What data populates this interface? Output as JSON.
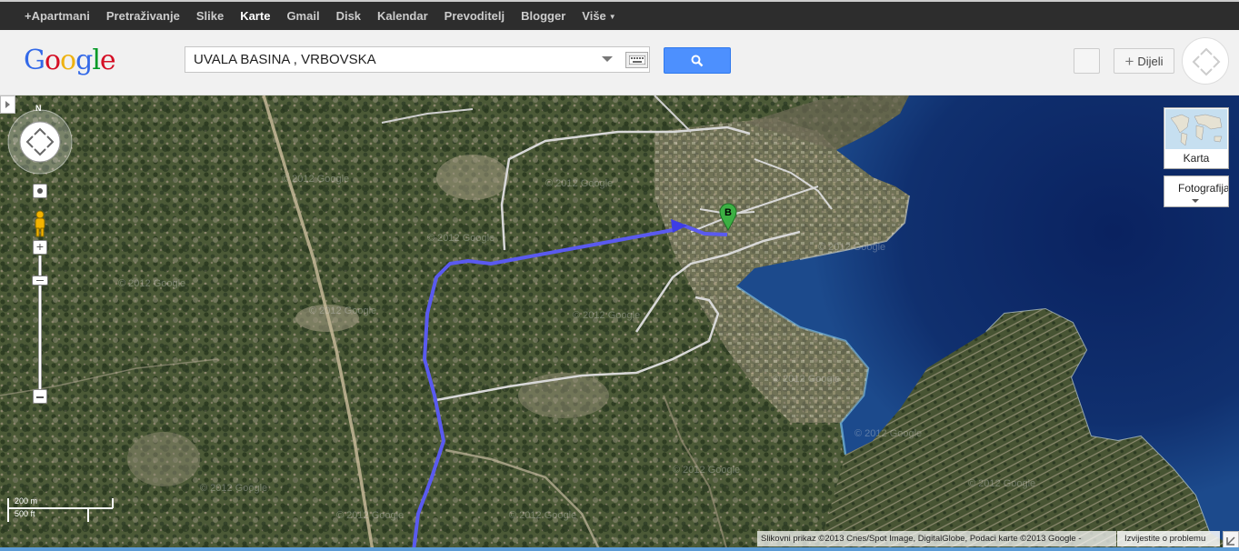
{
  "topbar": {
    "items": [
      {
        "label": "+Apartmani",
        "active": false
      },
      {
        "label": "Pretraživanje",
        "active": false
      },
      {
        "label": "Slike",
        "active": false
      },
      {
        "label": "Karte",
        "active": true
      },
      {
        "label": "Gmail",
        "active": false
      },
      {
        "label": "Disk",
        "active": false
      },
      {
        "label": "Kalendar",
        "active": false
      },
      {
        "label": "Prevoditelj",
        "active": false
      },
      {
        "label": "Blogger",
        "active": false
      },
      {
        "label": "Više",
        "active": false
      }
    ]
  },
  "header": {
    "logo_letters": [
      "G",
      "o",
      "o",
      "g",
      "l",
      "e"
    ],
    "search_value": "UVALA BASINA , VRBOVSKA",
    "share_label": "Dijeli"
  },
  "map": {
    "compass_label": "N",
    "marker_label": "B",
    "watermark_text": "© 2012 Google",
    "map_types": {
      "karta_label": "Karta",
      "foto_label": "Fotografija"
    },
    "scale": {
      "metric": "200 m",
      "imperial": "500 ft"
    },
    "copyright": "Slikovni prikaz ©2013 Cnes/Spot Image, DigitalGlobe, Podaci karte ©2013 Google -",
    "report_link": "Izvijestite o problemu",
    "colors": {
      "route": "#5a5af0",
      "marker": "#3cb043",
      "sea_deep": "#0d2a6b",
      "land": "#4f5a3a"
    }
  }
}
